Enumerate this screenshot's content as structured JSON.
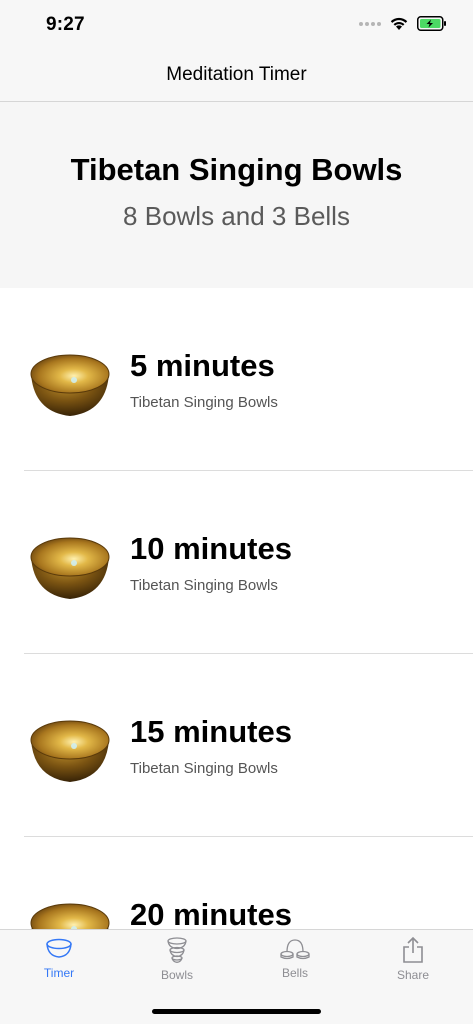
{
  "status_bar": {
    "time": "9:27"
  },
  "nav": {
    "title": "Meditation Timer"
  },
  "header": {
    "title": "Tibetan Singing Bowls",
    "subtitle": "8 Bowls and 3 Bells"
  },
  "list": {
    "items": [
      {
        "title": "5 minutes",
        "subtitle": "Tibetan Singing Bowls"
      },
      {
        "title": "10 minutes",
        "subtitle": "Tibetan Singing Bowls"
      },
      {
        "title": "15 minutes",
        "subtitle": "Tibetan Singing Bowls"
      },
      {
        "title": "20 minutes",
        "subtitle": ""
      }
    ]
  },
  "tab_bar": {
    "tabs": [
      {
        "label": "Timer",
        "icon": "bowl-icon",
        "active": true
      },
      {
        "label": "Bowls",
        "icon": "stacked-bowls-icon",
        "active": false
      },
      {
        "label": "Bells",
        "icon": "bells-icon",
        "active": false
      },
      {
        "label": "Share",
        "icon": "share-icon",
        "active": false
      }
    ]
  },
  "colors": {
    "accent": "#3478f6",
    "inactive": "#8e8e93",
    "battery": "#4cd964"
  }
}
